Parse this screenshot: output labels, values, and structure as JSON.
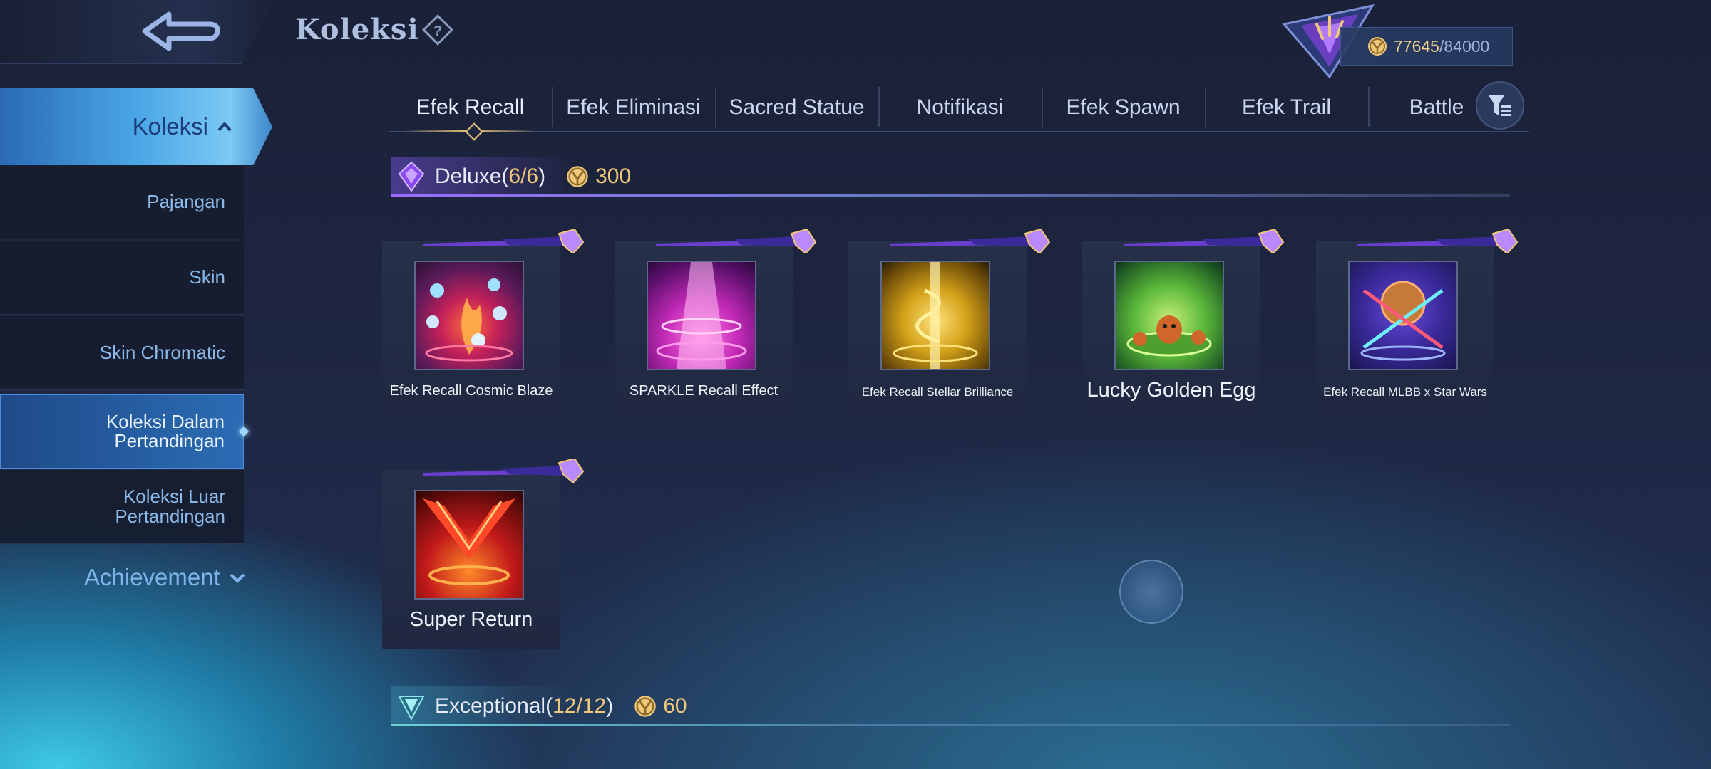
{
  "header": {
    "title": "Koleksi",
    "points_current": "77645",
    "points_separator": "/",
    "points_max": "84000"
  },
  "sidebar": {
    "active": {
      "label": "Koleksi"
    },
    "items": [
      {
        "label": "Pajangan"
      },
      {
        "label": "Skin"
      },
      {
        "label": "Skin Chromatic"
      },
      {
        "label": "Koleksi Dalam Pertandingan",
        "selected": true
      },
      {
        "label": "Koleksi Luar Pertandingan"
      }
    ],
    "achievement": "Achievement"
  },
  "tabs": [
    {
      "label": "Efek Recall",
      "active": true
    },
    {
      "label": "Efek Eliminasi"
    },
    {
      "label": "Sacred Statue"
    },
    {
      "label": "Notifikasi"
    },
    {
      "label": "Efek Spawn"
    },
    {
      "label": "Efek Trail"
    },
    {
      "label": "Battle"
    }
  ],
  "sections": {
    "deluxe": {
      "name": "Deluxe",
      "open": "(",
      "count": "6/6",
      "close": ")",
      "points": "300"
    },
    "exceptional": {
      "name": "Exceptional",
      "open": "(",
      "count": "12/12",
      "close": ")",
      "points": "60"
    }
  },
  "items": [
    {
      "name": "Efek Recall Cosmic Blaze"
    },
    {
      "name": "SPARKLE Recall Effect"
    },
    {
      "name": "Efek Recall Stellar Brilliance"
    },
    {
      "name": "Lucky Golden Egg"
    },
    {
      "name": "Efek Recall MLBB x Star Wars"
    },
    {
      "name": "Super Return"
    }
  ],
  "colors": {
    "accent_gold": "#f0c878",
    "deluxe_purple": "#9b6cff",
    "exceptional_teal": "#6fd2d6",
    "sidebar_active": "#4aa6e6"
  },
  "icons": [
    "back-arrow-icon",
    "help-icon",
    "rank-emblem-icon",
    "coin-icon",
    "chevron-up-icon",
    "chevron-down-icon",
    "filter-icon",
    "deluxe-gem-icon",
    "exceptional-gem-icon"
  ]
}
